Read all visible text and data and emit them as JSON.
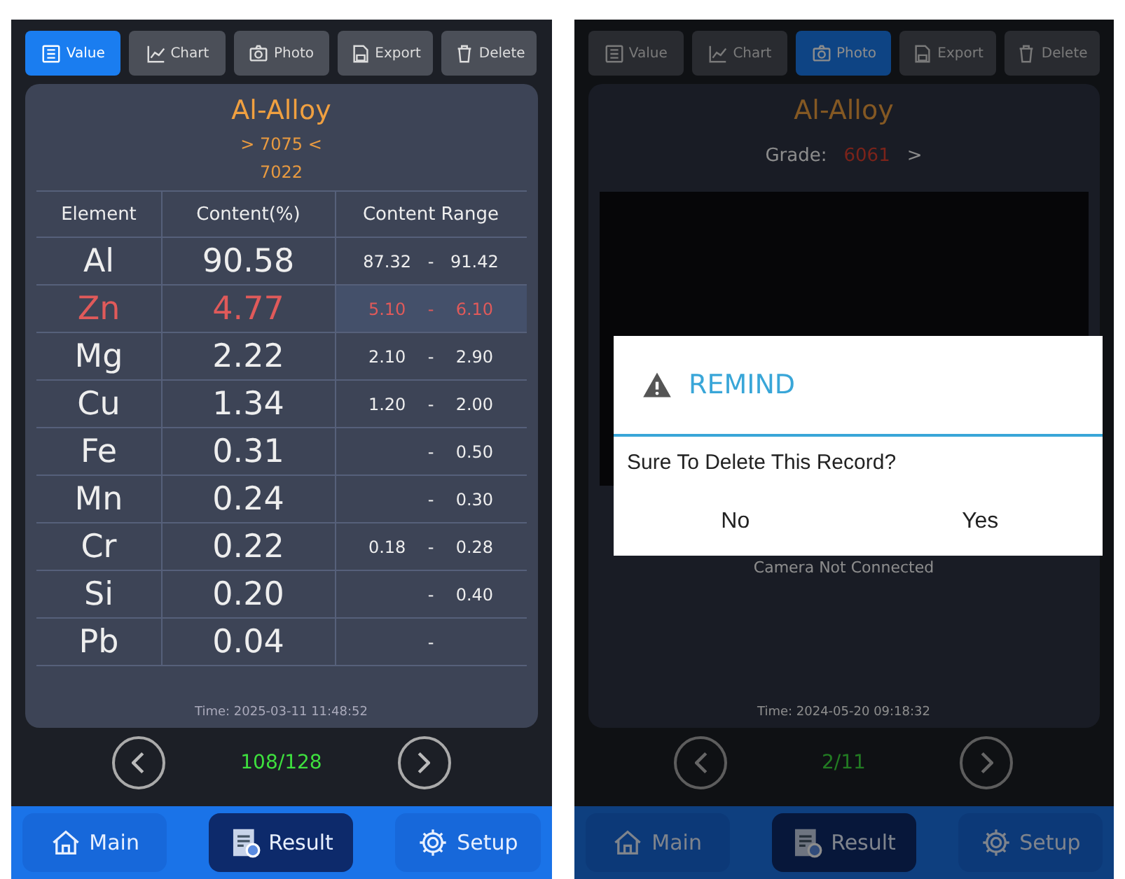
{
  "screens": [
    {
      "kind": "result",
      "tabs": [
        {
          "label": "Value",
          "selected": true
        },
        {
          "label": "Chart",
          "selected": false
        },
        {
          "label": "Photo",
          "selected": false
        },
        {
          "label": "Export",
          "selected": false
        },
        {
          "label": "Delete",
          "selected": false
        }
      ],
      "title": "Al-Alloy",
      "grade_line": "> 7075 <",
      "grade_alt": "7022",
      "table": {
        "columns": [
          "Element",
          "Content(%)",
          "Content Range"
        ],
        "rows": [
          {
            "element": "Al",
            "content": "90.58",
            "min": "87.32",
            "sep": "-",
            "max": "91.42",
            "alarm": false
          },
          {
            "element": "Zn",
            "content": "4.77",
            "min": "5.10",
            "sep": "-",
            "max": "6.10",
            "alarm": true
          },
          {
            "element": "Mg",
            "content": "2.22",
            "min": "2.10",
            "sep": "-",
            "max": "2.90",
            "alarm": false
          },
          {
            "element": "Cu",
            "content": "1.34",
            "min": "1.20",
            "sep": "-",
            "max": "2.00",
            "alarm": false
          },
          {
            "element": "Fe",
            "content": "0.31",
            "sep": "-",
            "max": "0.50",
            "alarm": false
          },
          {
            "element": "Mn",
            "content": "0.24",
            "sep": "-",
            "max": "0.30",
            "alarm": false
          },
          {
            "element": "Cr",
            "content": "0.22",
            "min": "0.18",
            "sep": "-",
            "max": "0.28",
            "alarm": false
          },
          {
            "element": "Si",
            "content": "0.20",
            "sep": "-",
            "max": "0.40",
            "alarm": false
          },
          {
            "element": "Pb",
            "content": "0.04",
            "sep": "-",
            "alarm": false
          }
        ]
      },
      "time": "Time: 2025-03-11 11:48:52",
      "pager": "108/128",
      "nav": [
        {
          "label": "Main",
          "selected": false
        },
        {
          "label": "Result",
          "selected": true
        },
        {
          "label": "Setup",
          "selected": false
        }
      ]
    },
    {
      "kind": "photo",
      "tabs": [
        {
          "label": "Value",
          "selected": false
        },
        {
          "label": "Chart",
          "selected": false
        },
        {
          "label": "Photo",
          "selected": true
        },
        {
          "label": "Export",
          "selected": false
        },
        {
          "label": "Delete",
          "selected": false
        }
      ],
      "title": "Al-Alloy",
      "grade_label": "Grade:",
      "grade": "6061",
      "grade_arrow": ">",
      "camera_status": "Camera Not Connected",
      "time": "Time: 2024-05-20 09:18:32",
      "pager": "2/11",
      "nav": [
        {
          "label": "Main",
          "selected": false
        },
        {
          "label": "Result",
          "selected": true
        },
        {
          "label": "Setup",
          "selected": false
        }
      ],
      "dialog": {
        "title": "REMIND",
        "message": "Sure To Delete This Record?",
        "buttons": [
          "No",
          "Yes"
        ]
      }
    }
  ]
}
